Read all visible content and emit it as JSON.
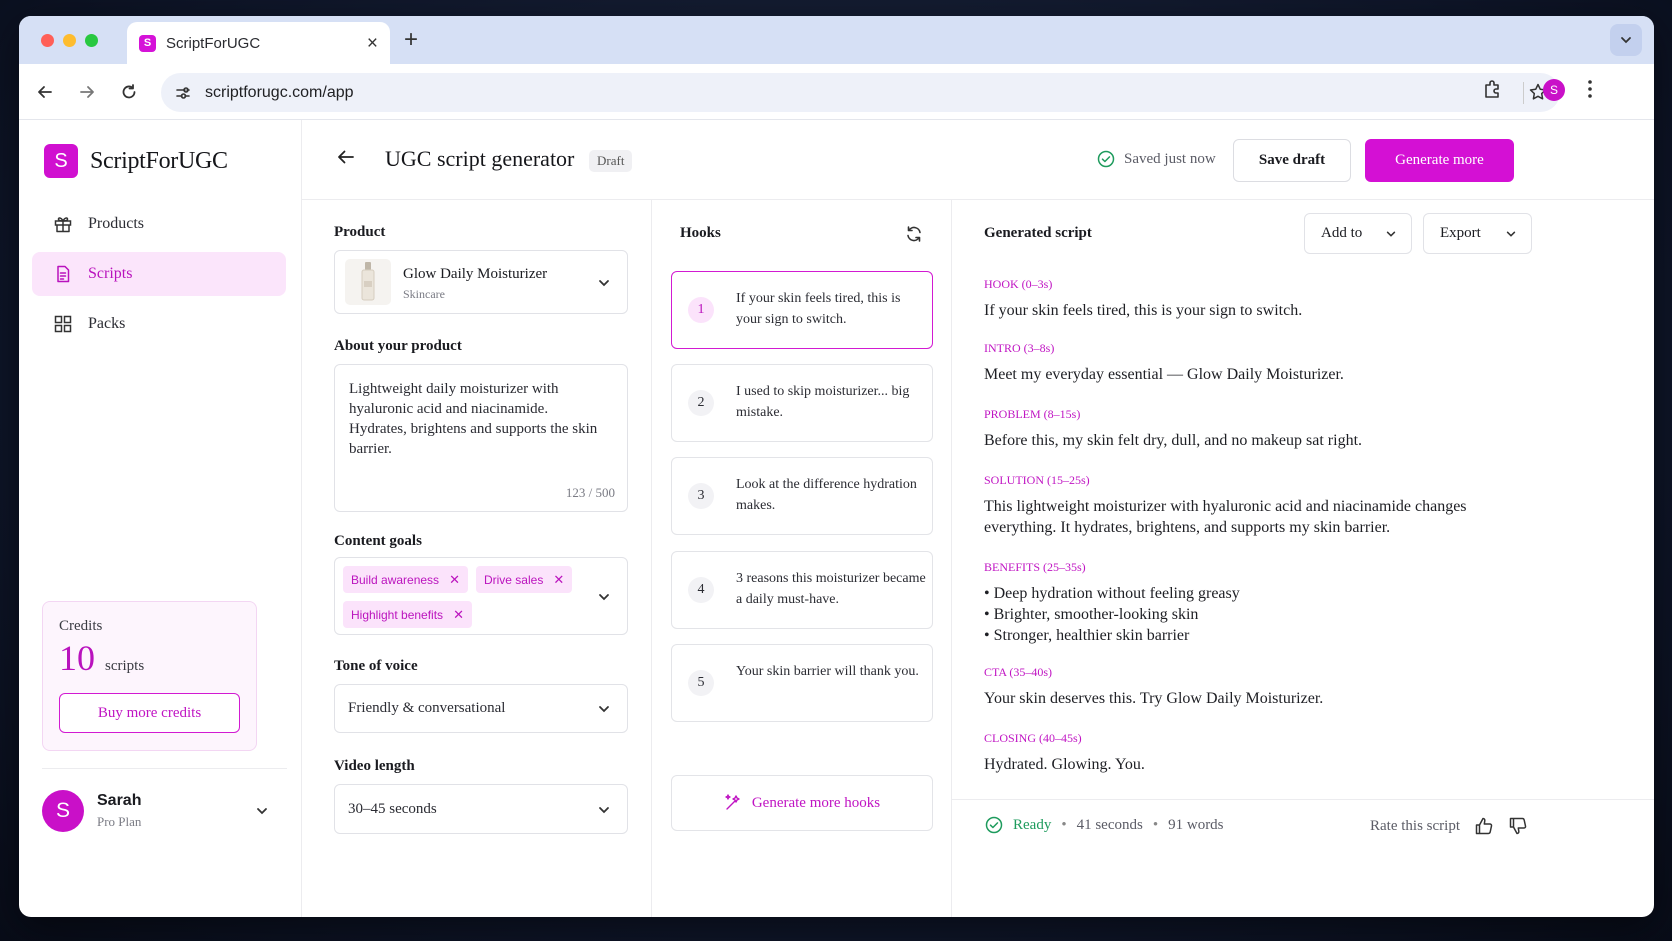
{
  "browser": {
    "tab_title": "ScriptForUGC",
    "favicon_letter": "S",
    "url": "scriptforugc.com/app",
    "profile_letter": "S"
  },
  "sidebar": {
    "logo_letter": "S",
    "logo_text": "ScriptForUGC",
    "items": [
      {
        "label": "Products",
        "icon": "gift-icon",
        "active": false
      },
      {
        "label": "Scripts",
        "icon": "document-icon",
        "active": true
      },
      {
        "label": "Packs",
        "icon": "grid-icon",
        "active": false
      }
    ],
    "credits": {
      "label": "Credits",
      "count": "10",
      "unit": "scripts",
      "buy_label": "Buy more credits"
    },
    "user": {
      "initial": "S",
      "name": "Sarah",
      "plan": "Pro Plan"
    }
  },
  "header": {
    "title": "UGC script generator",
    "badge": "Draft",
    "saved_status": "Saved just now",
    "save_draft_label": "Save draft",
    "generate_more_label": "Generate more"
  },
  "form": {
    "product_label": "Product",
    "product_name": "Glow Daily Moisturizer",
    "product_category": "Skincare",
    "about_label": "About your product",
    "about_text": "Lightweight daily moisturizer with hyaluronic acid and niacinamide. Hydrates, brightens and supports the skin barrier.",
    "about_counter": "123 / 500",
    "goals_label": "Content goals",
    "goals": [
      "Build awareness",
      "Drive sales",
      "Highlight benefits"
    ],
    "tone_label": "Tone of voice",
    "tone_value": "Friendly & conversational",
    "length_label": "Video length",
    "length_value": "30–45 seconds"
  },
  "hooks": {
    "title": "Hooks",
    "items": [
      {
        "num": "1",
        "text": "If your skin feels tired, this is your sign to switch.",
        "selected": true
      },
      {
        "num": "2",
        "text": "I used to skip moisturizer... big mistake.",
        "selected": false
      },
      {
        "num": "3",
        "text": "Look at the difference hydration makes.",
        "selected": false
      },
      {
        "num": "4",
        "text": "3 reasons this moisturizer became a daily must-have.",
        "selected": false
      },
      {
        "num": "5",
        "text": "Your skin barrier will thank you.",
        "selected": false
      }
    ],
    "generate_label": "Generate more hooks"
  },
  "script": {
    "title": "Generated script",
    "add_to_label": "Add to",
    "export_label": "Export",
    "sections": [
      {
        "label": "HOOK (0–3s)",
        "body": "If your skin feels tired, this is your sign to switch."
      },
      {
        "label": "INTRO (3–8s)",
        "body": "Meet my everyday essential — Glow Daily Moisturizer."
      },
      {
        "label": "PROBLEM (8–15s)",
        "body": "Before this, my skin felt dry, dull, and no makeup sat right."
      },
      {
        "label": "SOLUTION (15–25s)",
        "body": "This lightweight moisturizer with hyaluronic acid and niacinamide changes everything. It hydrates, brightens, and supports my skin barrier."
      },
      {
        "label": "BENEFITS (25–35s)",
        "bullets": [
          "Deep hydration without feeling greasy",
          "Brighter, smoother-looking skin",
          "Stronger, healthier skin barrier"
        ]
      },
      {
        "label": "CTA (35–40s)",
        "body": "Your skin deserves this. Try Glow Daily Moisturizer."
      },
      {
        "label": "CLOSING (40–45s)",
        "body": "Hydrated. Glowing. You."
      }
    ],
    "footer": {
      "status": "Ready",
      "duration": "41 seconds",
      "words": "91 words",
      "rate_label": "Rate this script"
    }
  },
  "colors": {
    "accent": "#d410d4",
    "accent_soft": "#fbe3fb",
    "ready": "#1e9b5d"
  }
}
